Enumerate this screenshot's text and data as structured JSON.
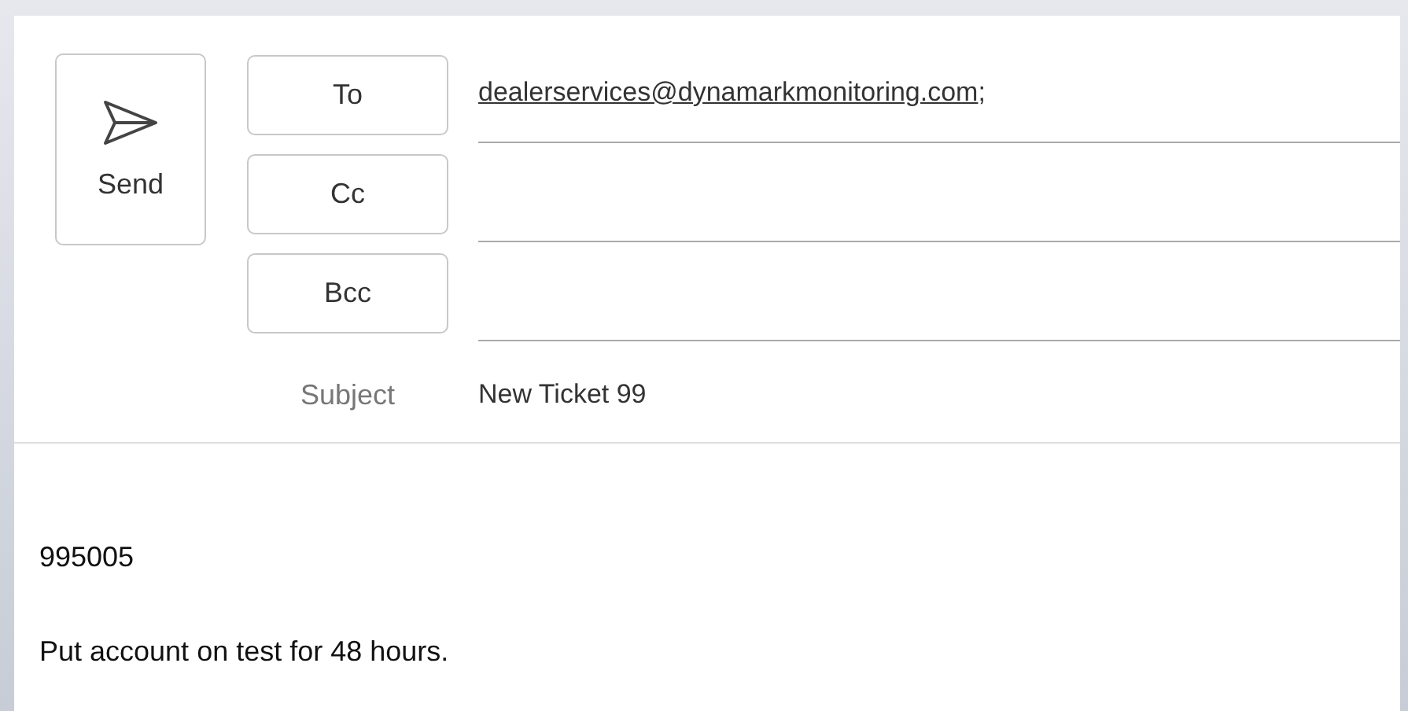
{
  "send_button": {
    "label": "Send"
  },
  "recipients": [
    {
      "label": "To",
      "value": "dealerservices@dynamarkmonitoring.com",
      "suffix": ";"
    },
    {
      "label": "Cc"
    },
    {
      "label": "Bcc"
    }
  ],
  "subject": {
    "label": "Subject",
    "value": "New Ticket 99"
  },
  "body": [
    "995005",
    "Put account on test for 48 hours."
  ]
}
